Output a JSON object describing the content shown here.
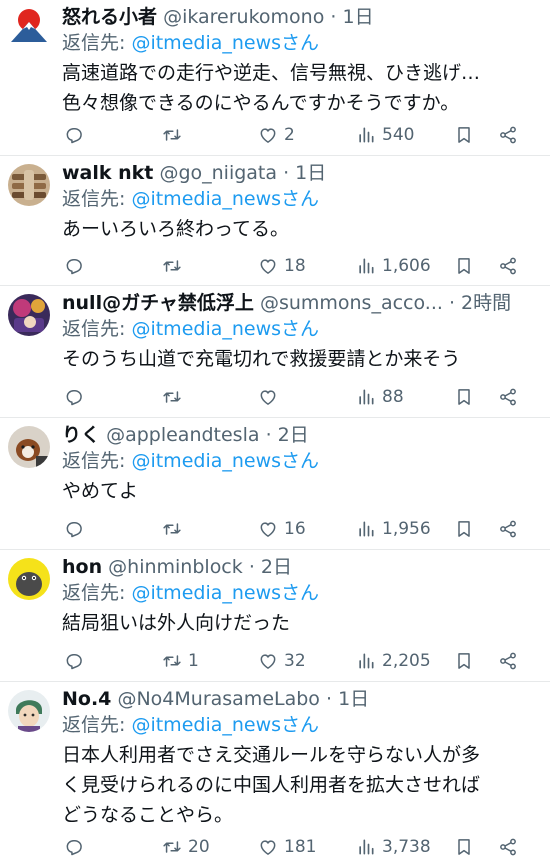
{
  "reply_prefix": "返信先:",
  "tweets": [
    {
      "name": "怒れる小者",
      "handle": "@ikarerukomono",
      "dot": "·",
      "time": "1日",
      "mention": "@itmedia_newsさん",
      "text": "高速道路での走行や逆走、信号無視、ひき逃げ…\n色々想像できるのにやるんですかそうですか。",
      "replies": "",
      "retweets": "",
      "likes": "2",
      "views": "540"
    },
    {
      "name": "walk nkt",
      "handle": "@go_niigata",
      "dot": "·",
      "time": "1日",
      "mention": "@itmedia_newsさん",
      "text": "あーいろいろ終わってる。",
      "replies": "",
      "retweets": "",
      "likes": "18",
      "views": "1,606"
    },
    {
      "name": "null@ガチャ禁低浮上",
      "handle": "@summons_acco...",
      "dot": "·",
      "time": "2時間",
      "mention": "@itmedia_newsさん",
      "text": "そのうち山道で充電切れで救援要請とか来そう",
      "replies": "",
      "retweets": "",
      "likes": "",
      "views": "88"
    },
    {
      "name": "りく",
      "handle": "@appleandtesla",
      "dot": "·",
      "time": "2日",
      "mention": "@itmedia_newsさん",
      "text": "やめてよ",
      "replies": "",
      "retweets": "",
      "likes": "16",
      "views": "1,956"
    },
    {
      "name": "hon",
      "handle": "@hinminblock",
      "dot": "·",
      "time": "2日",
      "mention": "@itmedia_newsさん",
      "text": "結局狙いは外人向けだった",
      "replies": "",
      "retweets": "1",
      "likes": "32",
      "views": "2,205"
    },
    {
      "name": "No.4",
      "handle": "@No4MurasameLabo",
      "dot": "·",
      "time": "1日",
      "mention": "@itmedia_newsさん",
      "text": "日本人利用者でさえ交通ルールを守らない人が多\nく見受けられるのに中国人利用者を拡大させれば\nどうなることやら。",
      "replies": "",
      "retweets": "20",
      "likes": "181",
      "views": "3,738"
    }
  ]
}
